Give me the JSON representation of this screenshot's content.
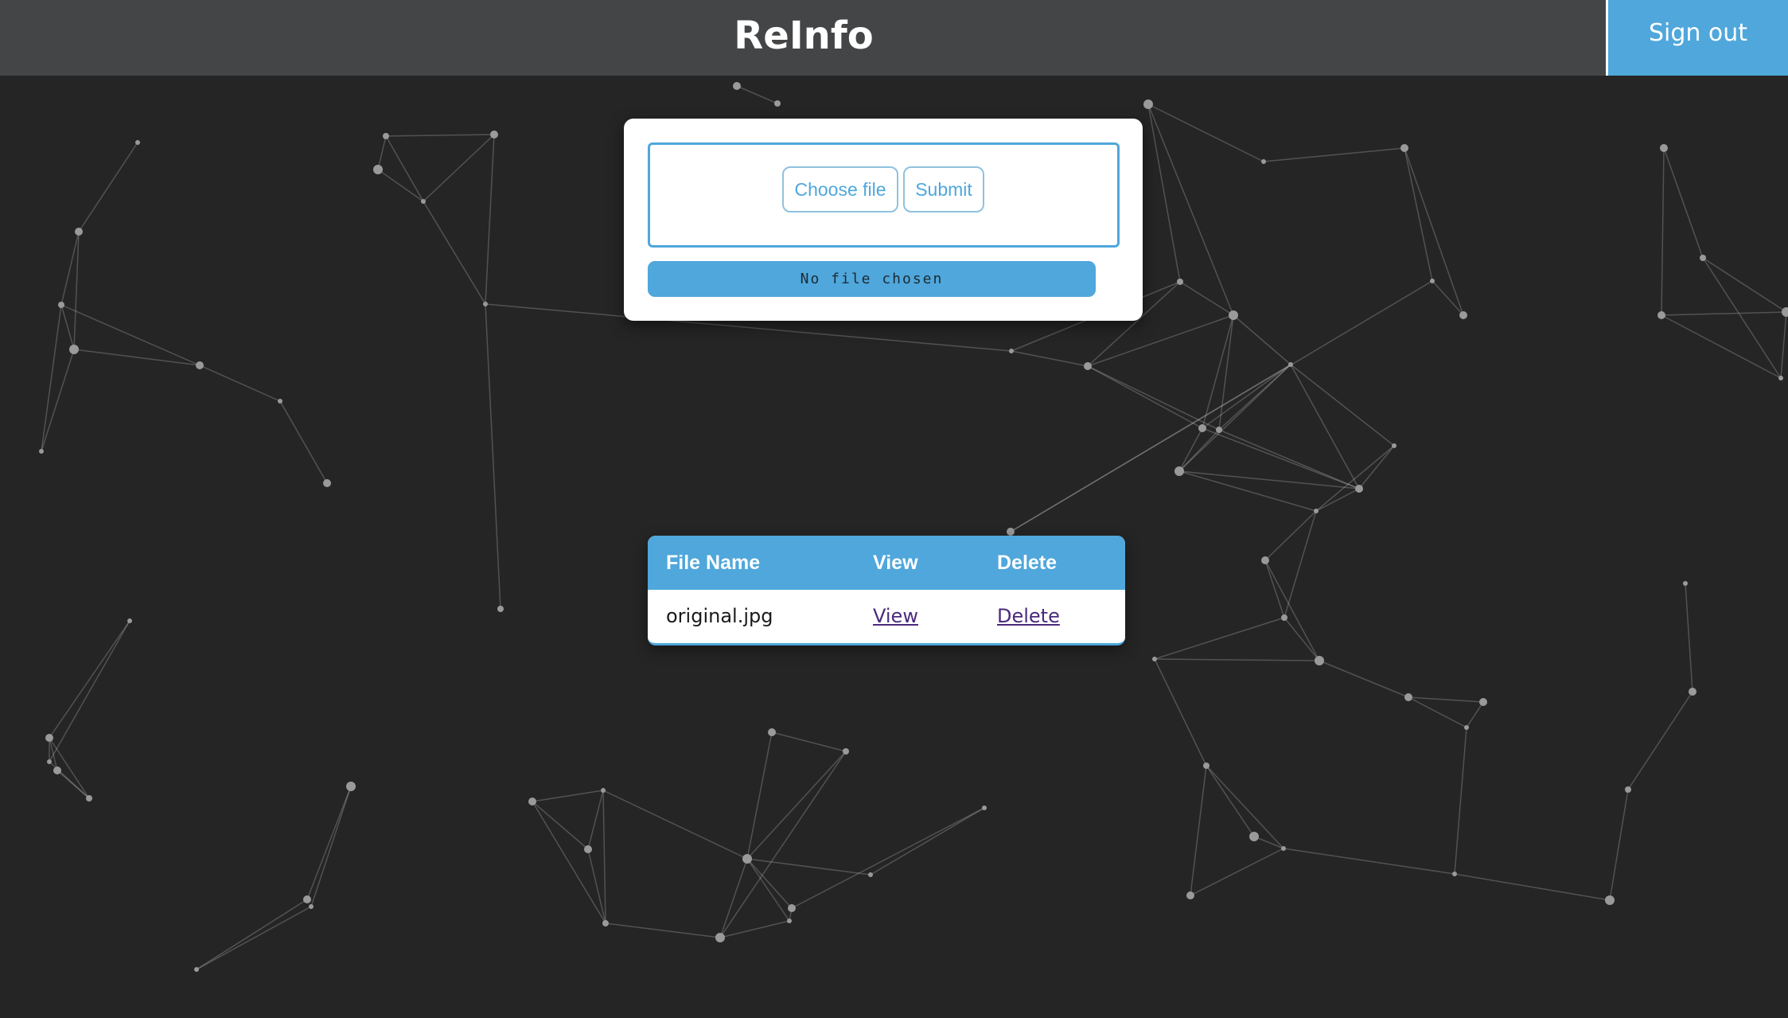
{
  "header": {
    "title": "ReInfo",
    "sign_out_label": "Sign out"
  },
  "upload": {
    "choose_label": "Choose file",
    "submit_label": "Submit",
    "status_text": "No file chosen"
  },
  "table": {
    "headers": [
      "File Name",
      "View",
      "Delete"
    ],
    "rows": [
      {
        "file_name": "original.jpg",
        "view_label": "View",
        "delete_label": "Delete"
      }
    ]
  },
  "colors": {
    "accent": "#4fa7dc",
    "header_bg": "#444547",
    "page_bg": "#252525"
  }
}
